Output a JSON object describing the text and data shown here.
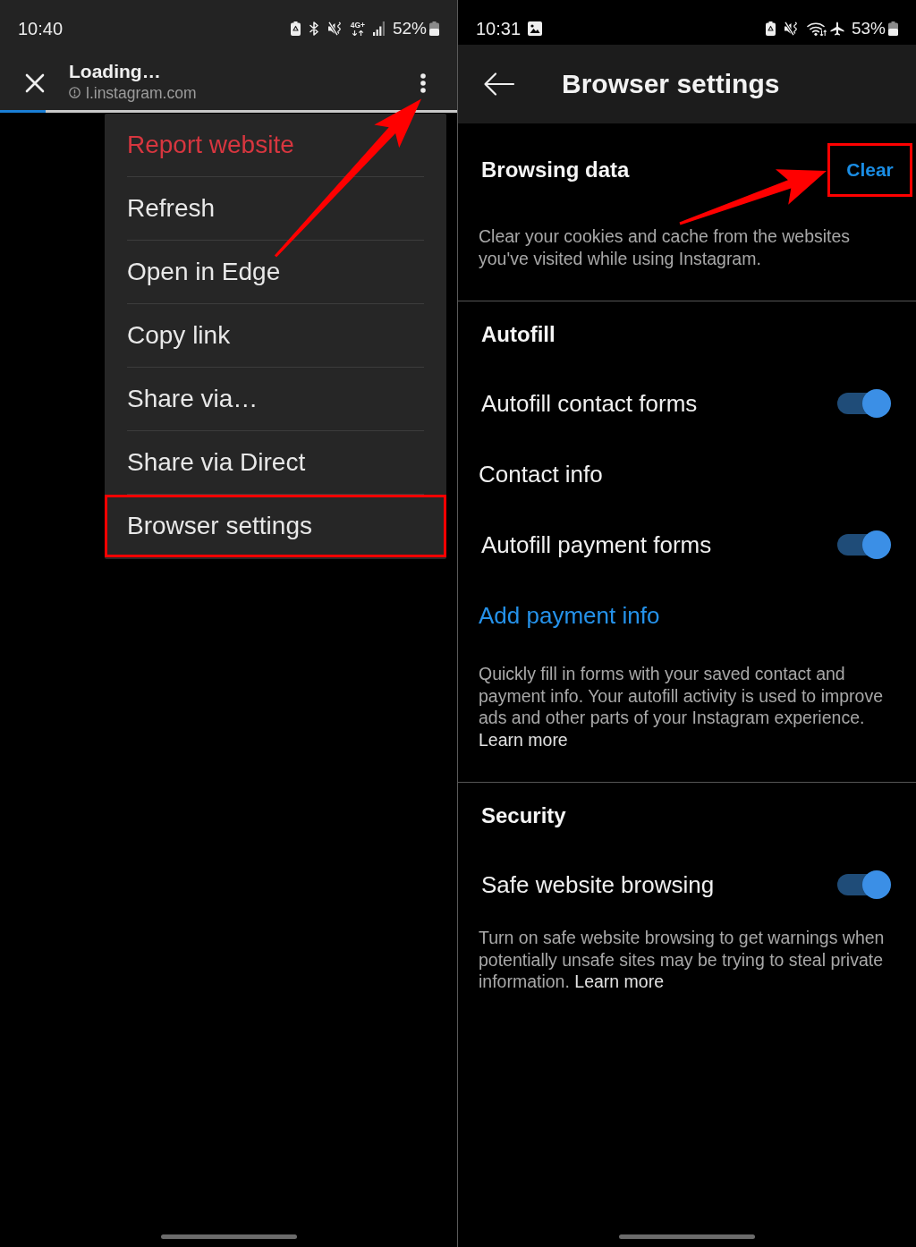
{
  "left_screen": {
    "status_bar": {
      "time": "10:40",
      "network": "4G+",
      "battery": "52%"
    },
    "toolbar": {
      "title": "Loading…",
      "url": "l.instagram.com",
      "more_button": {
        "pointer_arrow": true
      }
    },
    "progress": {
      "level": 0.1
    },
    "menu": {
      "items": [
        {
          "label": "Report website",
          "kind": "danger",
          "highlighted": false
        },
        {
          "label": "Refresh",
          "kind": "normal",
          "highlighted": false
        },
        {
          "label": "Open in Edge",
          "kind": "normal",
          "highlighted": false
        },
        {
          "label": "Copy link",
          "kind": "normal",
          "highlighted": false
        },
        {
          "label": "Share via…",
          "kind": "normal",
          "highlighted": false
        },
        {
          "label": "Share via Direct",
          "kind": "normal",
          "highlighted": false
        },
        {
          "label": "Browser settings",
          "kind": "normal",
          "highlighted": true
        }
      ]
    }
  },
  "right_screen": {
    "status_bar": {
      "time": "10:31",
      "battery": "53%"
    },
    "header": {
      "title": "Browser settings"
    },
    "sections": [
      {
        "title": "Browsing data",
        "action": {
          "label": "Clear",
          "highlighted": true,
          "pointer_arrow": true
        },
        "description": "Clear your cookies and cache from the websites you've visited while using Instagram."
      },
      {
        "title": "Autofill",
        "rows": [
          {
            "kind": "toggle",
            "label": "Autofill contact forms",
            "on": true
          },
          {
            "kind": "text",
            "label": "Contact info"
          },
          {
            "kind": "toggle",
            "label": "Autofill payment forms",
            "on": true
          },
          {
            "kind": "link",
            "label": "Add payment info"
          }
        ],
        "description": "Quickly fill in forms with your saved contact and payment info. Your autofill activity is used to improve ads and other parts of your Instagram experience.",
        "learn_more": "Learn more"
      },
      {
        "title": "Security",
        "rows": [
          {
            "kind": "toggle",
            "label": "Safe website browsing",
            "on": true
          }
        ],
        "description": "Turn on safe website browsing to get warnings when potentially unsafe sites may be trying to steal private information.",
        "learn_more": "Learn more"
      }
    ]
  }
}
